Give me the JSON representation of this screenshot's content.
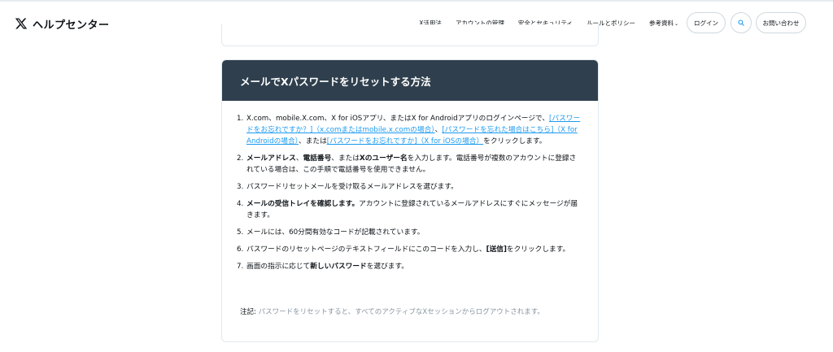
{
  "header": {
    "brand": "ヘルプセンター",
    "nav": [
      {
        "label": "X活用法"
      },
      {
        "label": "アカウントの管理"
      },
      {
        "label": "安全とセキュリティ"
      },
      {
        "label": "ルールとポリシー"
      },
      {
        "label": "参考資料"
      }
    ],
    "resources_chevron": "⌄",
    "login_label": "ログイン",
    "contact_label": "お問い合わせ"
  },
  "article": {
    "title": "メールでXパスワードをリセットする方法",
    "steps": [
      {
        "num": "1.",
        "t1": "X.com、mobile.X.com、X for iOSアプリ、またはX for Androidアプリのログインページで、",
        "link1": "[パスワードをお忘れですか？]（x.comまたはmobile.x.comの場合）",
        "t2": "、",
        "link2": "[パスワードを忘れた場合はこちら]（X for Androidの場合）",
        "t3": "、または",
        "link3": "[パスワードをお忘れですか]（X for iOSの場合）",
        "t4": "をクリックします。"
      },
      {
        "num": "2.",
        "b1": "メールアドレス",
        "t1": "、",
        "b2": "電話番号",
        "t2": "、または",
        "b3": "Xのユーザー名",
        "t3": "を入力します。電話番号が複数のアカウントに登録されている場合は、この手順で電話番号を使用できません。"
      },
      {
        "num": "3.",
        "t1": "パスワードリセットメールを受け取るメールアドレスを選びます。"
      },
      {
        "num": "4.",
        "b1": "メールの受信トレイを確認します。",
        "t1": "アカウントに登録されているメールアドレスにすぐにメッセージが届きます。"
      },
      {
        "num": "5.",
        "t1": "メールには、60分間有効なコードが記載されています。"
      },
      {
        "num": "6.",
        "t1": "パスワードのリセットページのテキストフィールドにこのコードを入力し、",
        "b1": "[送信]",
        "t2": "をクリックします。"
      },
      {
        "num": "7.",
        "t1": "画面の指示に応じて",
        "b1": "新しいパスワード",
        "t2": "を選びます。"
      }
    ],
    "note_label": "注記:",
    "note_text": "パスワードをリセットすると、すべてのアクティブなXセッションからログアウトされます。"
  }
}
